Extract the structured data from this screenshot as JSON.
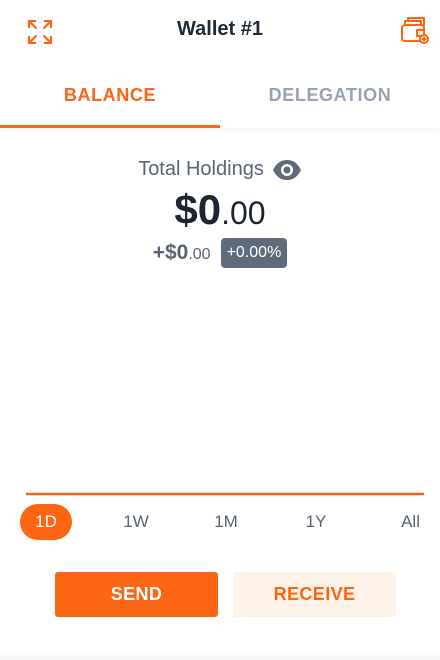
{
  "header": {
    "title": "Wallet #1",
    "left_icon": "expand-icon",
    "right_icon": "wallet-icon"
  },
  "tabs": [
    {
      "label": "BALANCE",
      "active": true
    },
    {
      "label": "DELEGATION",
      "active": false
    }
  ],
  "balance": {
    "holdings_label": "Total Holdings",
    "eye_icon": "eye-icon",
    "total_main": "$0",
    "total_decimal": ".00",
    "change_main": "+$0",
    "change_decimal": ".00",
    "change_percent": "+0.00%"
  },
  "ranges": [
    {
      "label": "1D",
      "active": true
    },
    {
      "label": "1W",
      "active": false
    },
    {
      "label": "1M",
      "active": false
    },
    {
      "label": "1Y",
      "active": false
    },
    {
      "label": "All",
      "active": false
    }
  ],
  "actions": {
    "send_label": "SEND",
    "receive_label": "RECEIVE"
  },
  "colors": {
    "accent": "#fb6514",
    "accent_light": "#fef3e9",
    "badge": "#5f6b7a"
  }
}
